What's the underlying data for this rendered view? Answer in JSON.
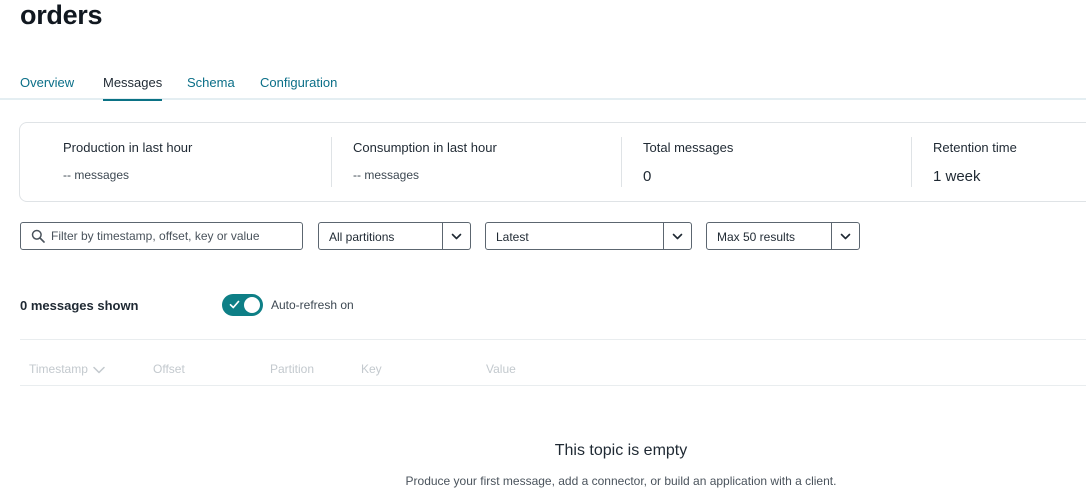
{
  "topic": {
    "title": "orders"
  },
  "tabs": [
    {
      "label": "Overview",
      "active": false
    },
    {
      "label": "Messages",
      "active": true
    },
    {
      "label": "Schema",
      "active": false
    },
    {
      "label": "Configuration",
      "active": false
    }
  ],
  "stats": [
    {
      "label": "Production in last hour",
      "value": "-- messages"
    },
    {
      "label": "Consumption in last hour",
      "value": "-- messages"
    },
    {
      "label": "Total messages",
      "value": "0"
    },
    {
      "label": "Retention time",
      "value": "1 week"
    }
  ],
  "filters": {
    "search": {
      "placeholder": "Filter by timestamp, offset, key or value",
      "value": ""
    },
    "partitions": "All partitions",
    "position": "Latest",
    "limit": "Max 50 results"
  },
  "messages": {
    "shown_label": "0 messages shown",
    "auto_refresh_label": "Auto-refresh on",
    "auto_refresh_enabled": true
  },
  "table": {
    "columns": [
      "Timestamp",
      "Offset",
      "Partition",
      "Key",
      "Value"
    ]
  },
  "empty_state": {
    "title": "This topic is empty",
    "subtitle": "Produce your first message, add a connector, or build an application with a client."
  },
  "colors": {
    "accent": "#0e7f86",
    "link": "#0b6f88",
    "border": "#dfe3e6"
  }
}
